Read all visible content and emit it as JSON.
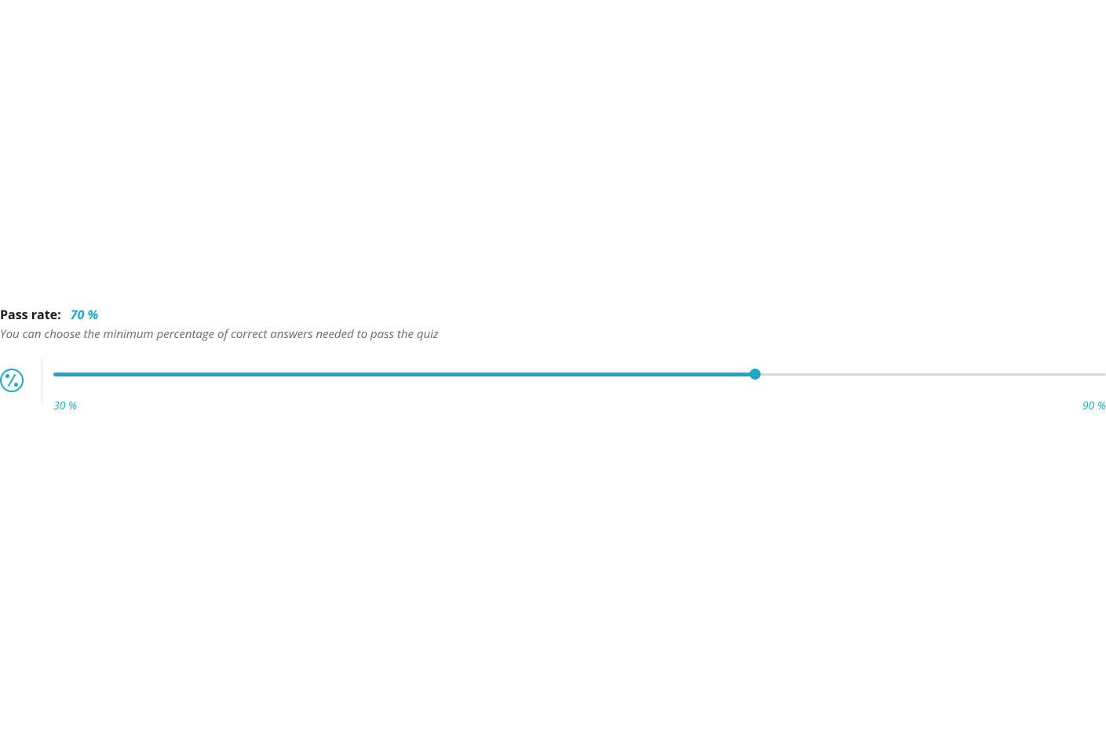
{
  "passRate": {
    "label": "Pass rate:",
    "value": "70 %",
    "description": "You can choose the minimum percentage of correct answers needed to pass the quiz",
    "slider": {
      "min": 30,
      "max": 90,
      "current": 70,
      "minLabel": "30 %",
      "maxLabel": "90 %",
      "fillPercent": "66.67%"
    }
  },
  "colors": {
    "accent": "#1da8c6",
    "textMuted": "#6a6a6a",
    "trackBg": "#d8d8da"
  }
}
